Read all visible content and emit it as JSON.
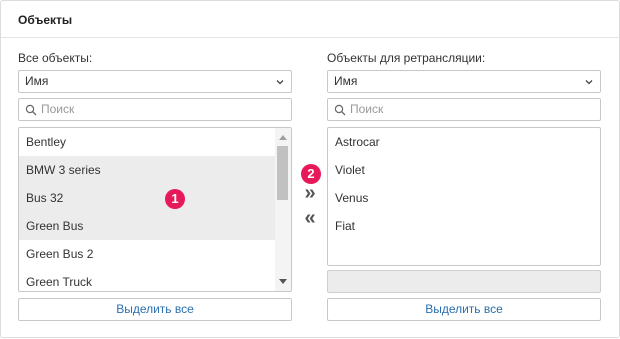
{
  "panel": {
    "title": "Объекты"
  },
  "left": {
    "label": "Все объекты:",
    "sort_value": "Имя",
    "search_placeholder": "Поиск",
    "items": [
      "Bentley",
      "BMW 3 series",
      "Bus 32",
      "Green Bus",
      "Green Bus 2",
      "Green Truck"
    ],
    "selected_indices": [
      1,
      2,
      3
    ],
    "select_all_label": "Выделить все"
  },
  "right": {
    "label": "Объекты для ретрансляции:",
    "sort_value": "Имя",
    "search_placeholder": "Поиск",
    "items": [
      "Astrocar",
      "Violet",
      "Venus",
      "Fiat"
    ],
    "select_all_label": "Выделить все"
  },
  "controls": {
    "move_right": "»",
    "move_left": "«"
  },
  "badges": {
    "one": "1",
    "two": "2"
  },
  "colors": {
    "accent": "#e8195a",
    "link": "#2a6fb0"
  }
}
